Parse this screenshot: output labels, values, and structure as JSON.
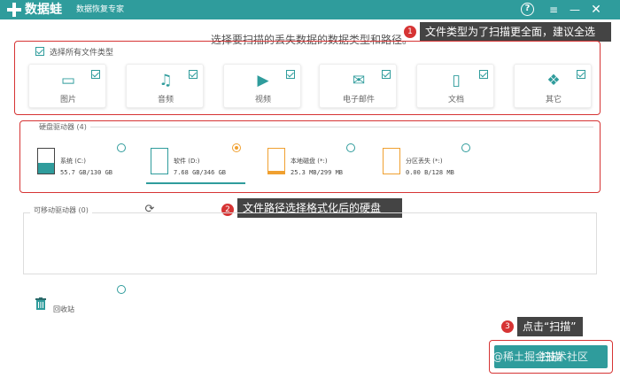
{
  "titlebar": {
    "app_name": "数据蛙",
    "subtitle": "数据恢复专家",
    "buttons": {
      "help": "?",
      "menu": "≡",
      "minimize": "—",
      "close": "✕"
    }
  },
  "instruction": "选择要扫描的丢失数据的数据类型和路径。",
  "callouts": [
    {
      "num": "1",
      "text": "文件类型为了扫描更全面，建议全选"
    },
    {
      "num": "2",
      "text": "文件路径选择格式化后的硬盘"
    },
    {
      "num": "3",
      "text": "点击“扫描”"
    }
  ],
  "select_all_label": "选择所有文件类型",
  "file_types": [
    {
      "label": "图片",
      "icon": "image-icon",
      "checked": true
    },
    {
      "label": "音频",
      "icon": "music-icon",
      "checked": true
    },
    {
      "label": "视频",
      "icon": "video-icon",
      "checked": true
    },
    {
      "label": "电子邮件",
      "icon": "email-icon",
      "checked": true
    },
    {
      "label": "文档",
      "icon": "document-icon",
      "checked": true
    },
    {
      "label": "其它",
      "icon": "other-icon",
      "checked": true
    }
  ],
  "hard_drives": {
    "title": "硬盘驱动器 (4)",
    "drives": [
      {
        "name": "系统 (C:)",
        "size": "55.7 GB/130 GB",
        "selected": false,
        "fill": 0.43
      },
      {
        "name": "软件 (D:)",
        "size": "7.68 GB/346 GB",
        "selected": true,
        "fill": 0.02
      },
      {
        "name": "本地磁盘 (*:)",
        "size": "25.3 MB/299 MB",
        "selected": false,
        "fill": 0.08
      },
      {
        "name": "分区丢失 (*:)",
        "size": "0.00  B/128 MB",
        "selected": false,
        "fill": 0.0
      }
    ]
  },
  "removable": {
    "title": "可移动驱动器 (0)"
  },
  "recycle_bin_label": "回收站",
  "scan_button": "扫描",
  "watermark": "@稀土掘金技术社区",
  "colors": {
    "accent": "#2f9c9c",
    "highlight": "#d63434",
    "selected_radio": "#f0a030"
  }
}
